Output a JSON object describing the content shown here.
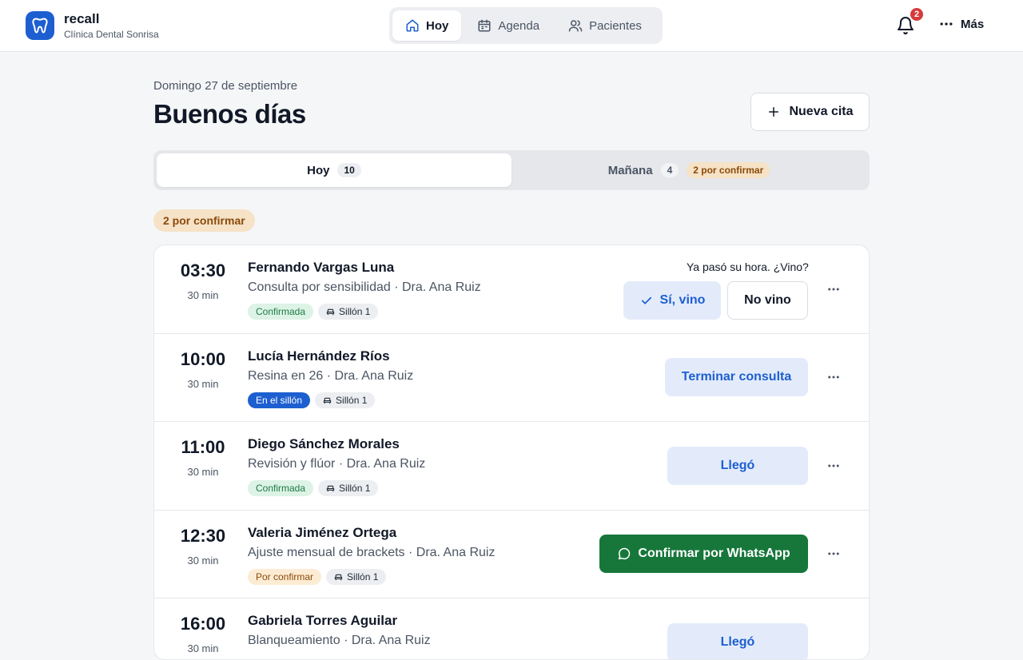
{
  "brand": {
    "name": "recall",
    "clinic": "Clínica Dental Sonrisa",
    "logo_icon": "tooth-icon",
    "accent": "#1d5fd0"
  },
  "nav": {
    "items": [
      {
        "label": "Hoy",
        "icon": "home-icon",
        "active": true
      },
      {
        "label": "Agenda",
        "icon": "calendar-icon",
        "active": false
      },
      {
        "label": "Pacientes",
        "icon": "users-icon",
        "active": false
      }
    ]
  },
  "header": {
    "notifications_count": "2",
    "more_label": "Más"
  },
  "main": {
    "date": "Domingo 27 de septiembre",
    "greeting": "Buenos días",
    "new_appointment_label": "Nueva cita",
    "tabs": [
      {
        "label": "Hoy",
        "count": "10",
        "active": true
      },
      {
        "label": "Mañana",
        "count": "4",
        "pending": "2 por confirmar",
        "active": false
      }
    ],
    "section_label": "2 por confirmar"
  },
  "appointments": [
    {
      "time": "03:30",
      "duration": "30 min",
      "patient": "Fernando Vargas Luna",
      "detail": "Consulta por sensibilidad · Dra. Ana Ruiz",
      "status": "Confirmada",
      "status_color": "green",
      "chair": "Sillón 1",
      "question": "Ya pasó su hora. ¿Vino?",
      "actions": [
        "Sí, vino",
        "No vino"
      ]
    },
    {
      "time": "10:00",
      "duration": "30 min",
      "patient": "Lucía Hernández Ríos",
      "detail": "Resina en 26 · Dra. Ana Ruiz",
      "status": "En el sillón",
      "status_color": "blue",
      "chair": "Sillón 1",
      "actions": [
        "Terminar consulta"
      ]
    },
    {
      "time": "11:00",
      "duration": "30 min",
      "patient": "Diego Sánchez Morales",
      "detail": "Revisión y flúor · Dra. Ana Ruiz",
      "status": "Confirmada",
      "status_color": "green",
      "chair": "Sillón 1",
      "actions": [
        "Llegó"
      ]
    },
    {
      "time": "12:30",
      "duration": "30 min",
      "patient": "Valeria Jiménez Ortega",
      "detail": "Ajuste mensual de brackets · Dra. Ana Ruiz",
      "status": "Por confirmar",
      "status_color": "amber",
      "chair": "Sillón 1",
      "actions": [
        "Confirmar por WhatsApp"
      ]
    },
    {
      "time": "16:00",
      "duration": "30 min",
      "patient": "Gabriela Torres Aguilar",
      "detail": "Blanqueamiento · Dra. Ana Ruiz",
      "actions": [
        "Llegó"
      ]
    }
  ]
}
